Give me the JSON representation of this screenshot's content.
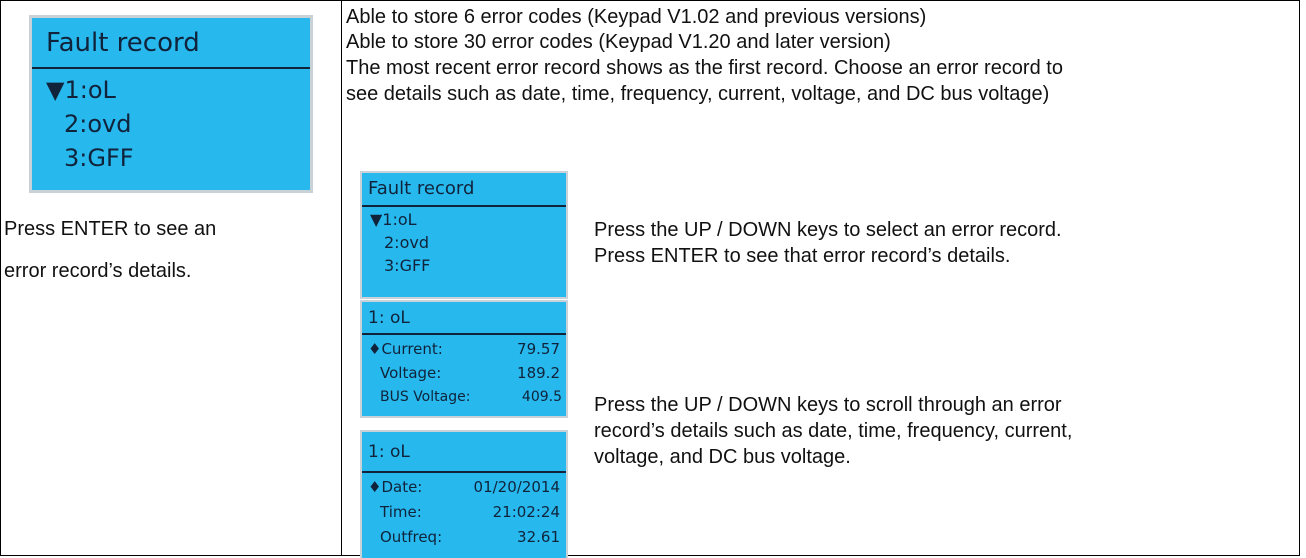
{
  "big_lcd": {
    "title": "Fault record",
    "items": [
      "▼1:oL",
      "2:ovd",
      "3:GFF"
    ]
  },
  "left_text": [
    "Press ENTER to see an",
    "error record’s details."
  ],
  "description": [
    "Able to store 6 error codes (Keypad V1.02 and previous versions)",
    "Able to store 30 error codes (Keypad V1.20 and later version)",
    "The most recent error record shows as the first record. Choose an error record to",
    "see details such as date, time, frequency, current, voltage, and DC bus voltage)"
  ],
  "small_lcd_1": {
    "title": "Fault record",
    "items": [
      "▼1:oL",
      "2:ovd",
      "3:GFF"
    ]
  },
  "small_lcd_2": {
    "title": "1: oL",
    "rows": [
      {
        "label": "♦Current:",
        "value": "79.57"
      },
      {
        "label": "Voltage:",
        "value": "189.2"
      },
      {
        "label": "BUS Voltage:",
        "value": "409.5"
      }
    ]
  },
  "small_lcd_3": {
    "title": "1: oL",
    "rows": [
      {
        "label": "♦Date:",
        "value": "01/20/2014"
      },
      {
        "label": "Time:",
        "value": "21:02:24"
      },
      {
        "label": "Outfreq:",
        "value": "32.61"
      }
    ]
  },
  "instruction_1": [
    "Press the UP / DOWN keys to select an error record.",
    "Press ENTER to see that error record’s details."
  ],
  "instruction_2": [
    "Press the UP / DOWN keys to scroll through an error",
    "record’s details such as date, time, frequency, current,",
    "voltage, and DC bus voltage."
  ],
  "colors": {
    "lcd_bg": "#27b8ee",
    "lcd_text": "#10233a",
    "lcd_border": "#c9d2d8"
  }
}
